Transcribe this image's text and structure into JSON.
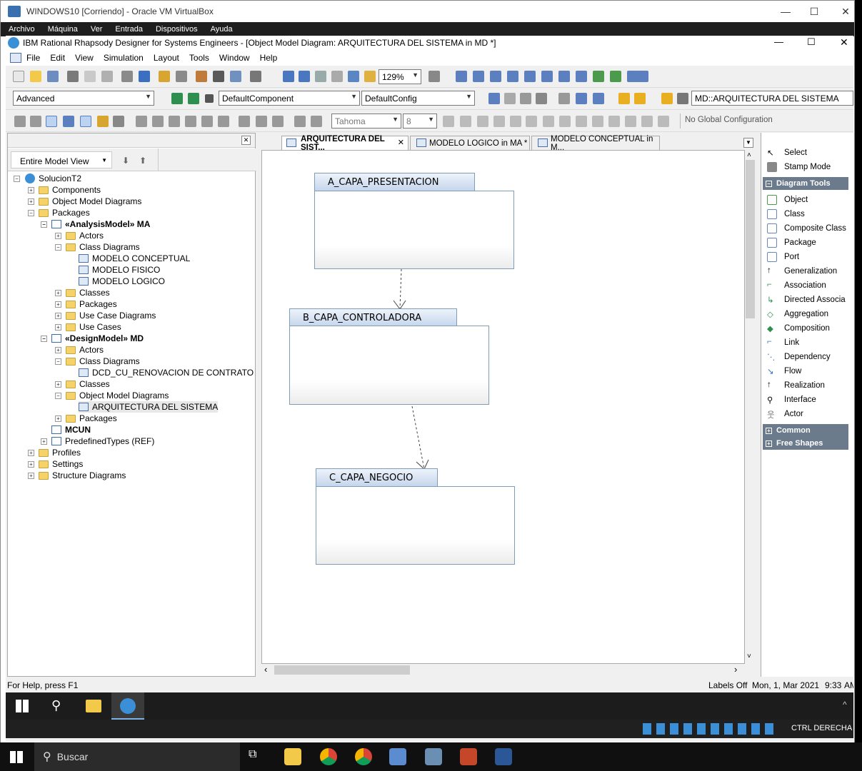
{
  "vbox": {
    "title": "WINDOWS10 [Corriendo] - Oracle VM VirtualBox",
    "menu": [
      "Archivo",
      "Máquina",
      "Ver",
      "Entrada",
      "Dispositivos",
      "Ayuda"
    ],
    "minimize": "—",
    "maximize": "☐",
    "close": "✕"
  },
  "rhapsody": {
    "title": "IBM Rational Rhapsody Designer for Systems Engineers - [Object Model Diagram: ARQUITECTURA DEL SISTEMA in MD *]",
    "menu": [
      "File",
      "Edit",
      "View",
      "Simulation",
      "Layout",
      "Tools",
      "Window",
      "Help"
    ],
    "zoom": "129%",
    "profile": "Advanced",
    "component": "DefaultComponent",
    "config": "DefaultConfig",
    "location": "MD::ARQUITECTURA DEL SISTEMA",
    "font": "Tahoma",
    "font_size": "8",
    "global_config": "No Global Configuration",
    "close_glyph": "✕",
    "scroll_left": "‹",
    "scroll_right": "›",
    "scroll_up": "˄",
    "scroll_down": "˅"
  },
  "browser": {
    "view": "Entire Model View",
    "tree": [
      {
        "label": "SolucionT2"
      },
      {
        "label": "Components"
      },
      {
        "label": "Object Model Diagrams"
      },
      {
        "label": "Packages"
      },
      {
        "label": "«AnalysisModel» MA"
      },
      {
        "label": "Actors"
      },
      {
        "label": "Class Diagrams"
      },
      {
        "label": "MODELO CONCEPTUAL"
      },
      {
        "label": "MODELO FISICO"
      },
      {
        "label": "MODELO LOGICO"
      },
      {
        "label": "Classes"
      },
      {
        "label": "Packages"
      },
      {
        "label": "Use Case Diagrams"
      },
      {
        "label": "Use Cases"
      },
      {
        "label": "«DesignModel» MD"
      },
      {
        "label": "Actors"
      },
      {
        "label": "Class Diagrams"
      },
      {
        "label": "DCD_CU_RENOVACION DE CONTRATO"
      },
      {
        "label": "Classes"
      },
      {
        "label": "Object Model Diagrams"
      },
      {
        "label": "ARQUITECTURA DEL SISTEMA"
      },
      {
        "label": "Packages"
      },
      {
        "label": "MCUN"
      },
      {
        "label": "PredefinedTypes (REF)"
      },
      {
        "label": "Profiles"
      },
      {
        "label": "Settings"
      },
      {
        "label": "Structure Diagrams"
      }
    ]
  },
  "tabs": [
    "ARQUITECTURA DEL SIST...",
    "MODELO LOGICO in MA *",
    "MODELO CONCEPTUAL in M..."
  ],
  "diagram": {
    "objects": [
      "A_CAPA_PRESENTACION",
      "B_CAPA_CONTROLADORA",
      "C_CAPA_NEGOCIO"
    ]
  },
  "palette": {
    "top": [
      "Select",
      "Stamp Mode"
    ],
    "section": "Diagram Tools",
    "tools": [
      "Object",
      "Class",
      "Composite Class",
      "Package",
      "Port",
      "Generalization",
      "Association",
      "Directed Associa",
      "Aggregation",
      "Composition",
      "Link",
      "Dependency",
      "Flow",
      "Realization",
      "Interface",
      "Actor"
    ],
    "sections_collapsed": [
      "Common",
      "Free Shapes"
    ]
  },
  "status": {
    "help": "For Help, press F1",
    "labels": "Labels Off",
    "date": "Mon, 1, Mar 2021",
    "time": "9:33",
    "am": "AM"
  },
  "host": {
    "search": "Buscar",
    "tray_label": "CTRL DERECHA"
  }
}
